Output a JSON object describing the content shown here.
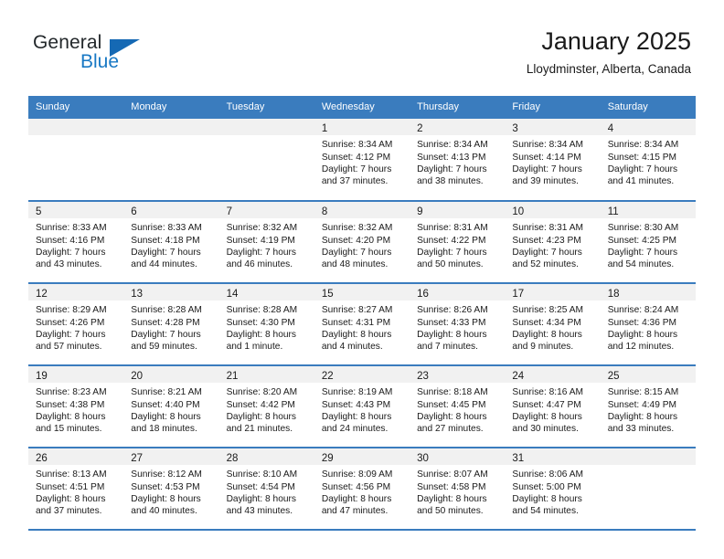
{
  "brand": {
    "name_part1": "General",
    "name_part2": "Blue",
    "triangle_color": "#1569b4"
  },
  "header": {
    "title": "January 2025",
    "location": "Lloydminster, Alberta, Canada"
  },
  "theme": {
    "header_blue": "#3a7cbe",
    "band_gray": "#f1f1f1",
    "text": "#1a1a1a"
  },
  "weekday_headers": [
    "Sunday",
    "Monday",
    "Tuesday",
    "Wednesday",
    "Thursday",
    "Friday",
    "Saturday"
  ],
  "weeks": [
    [
      {
        "day": "",
        "lines": []
      },
      {
        "day": "",
        "lines": []
      },
      {
        "day": "",
        "lines": []
      },
      {
        "day": "1",
        "lines": [
          "Sunrise: 8:34 AM",
          "Sunset: 4:12 PM",
          "Daylight: 7 hours",
          "and 37 minutes."
        ]
      },
      {
        "day": "2",
        "lines": [
          "Sunrise: 8:34 AM",
          "Sunset: 4:13 PM",
          "Daylight: 7 hours",
          "and 38 minutes."
        ]
      },
      {
        "day": "3",
        "lines": [
          "Sunrise: 8:34 AM",
          "Sunset: 4:14 PM",
          "Daylight: 7 hours",
          "and 39 minutes."
        ]
      },
      {
        "day": "4",
        "lines": [
          "Sunrise: 8:34 AM",
          "Sunset: 4:15 PM",
          "Daylight: 7 hours",
          "and 41 minutes."
        ]
      }
    ],
    [
      {
        "day": "5",
        "lines": [
          "Sunrise: 8:33 AM",
          "Sunset: 4:16 PM",
          "Daylight: 7 hours",
          "and 43 minutes."
        ]
      },
      {
        "day": "6",
        "lines": [
          "Sunrise: 8:33 AM",
          "Sunset: 4:18 PM",
          "Daylight: 7 hours",
          "and 44 minutes."
        ]
      },
      {
        "day": "7",
        "lines": [
          "Sunrise: 8:32 AM",
          "Sunset: 4:19 PM",
          "Daylight: 7 hours",
          "and 46 minutes."
        ]
      },
      {
        "day": "8",
        "lines": [
          "Sunrise: 8:32 AM",
          "Sunset: 4:20 PM",
          "Daylight: 7 hours",
          "and 48 minutes."
        ]
      },
      {
        "day": "9",
        "lines": [
          "Sunrise: 8:31 AM",
          "Sunset: 4:22 PM",
          "Daylight: 7 hours",
          "and 50 minutes."
        ]
      },
      {
        "day": "10",
        "lines": [
          "Sunrise: 8:31 AM",
          "Sunset: 4:23 PM",
          "Daylight: 7 hours",
          "and 52 minutes."
        ]
      },
      {
        "day": "11",
        "lines": [
          "Sunrise: 8:30 AM",
          "Sunset: 4:25 PM",
          "Daylight: 7 hours",
          "and 54 minutes."
        ]
      }
    ],
    [
      {
        "day": "12",
        "lines": [
          "Sunrise: 8:29 AM",
          "Sunset: 4:26 PM",
          "Daylight: 7 hours",
          "and 57 minutes."
        ]
      },
      {
        "day": "13",
        "lines": [
          "Sunrise: 8:28 AM",
          "Sunset: 4:28 PM",
          "Daylight: 7 hours",
          "and 59 minutes."
        ]
      },
      {
        "day": "14",
        "lines": [
          "Sunrise: 8:28 AM",
          "Sunset: 4:30 PM",
          "Daylight: 8 hours",
          "and 1 minute."
        ]
      },
      {
        "day": "15",
        "lines": [
          "Sunrise: 8:27 AM",
          "Sunset: 4:31 PM",
          "Daylight: 8 hours",
          "and 4 minutes."
        ]
      },
      {
        "day": "16",
        "lines": [
          "Sunrise: 8:26 AM",
          "Sunset: 4:33 PM",
          "Daylight: 8 hours",
          "and 7 minutes."
        ]
      },
      {
        "day": "17",
        "lines": [
          "Sunrise: 8:25 AM",
          "Sunset: 4:34 PM",
          "Daylight: 8 hours",
          "and 9 minutes."
        ]
      },
      {
        "day": "18",
        "lines": [
          "Sunrise: 8:24 AM",
          "Sunset: 4:36 PM",
          "Daylight: 8 hours",
          "and 12 minutes."
        ]
      }
    ],
    [
      {
        "day": "19",
        "lines": [
          "Sunrise: 8:23 AM",
          "Sunset: 4:38 PM",
          "Daylight: 8 hours",
          "and 15 minutes."
        ]
      },
      {
        "day": "20",
        "lines": [
          "Sunrise: 8:21 AM",
          "Sunset: 4:40 PM",
          "Daylight: 8 hours",
          "and 18 minutes."
        ]
      },
      {
        "day": "21",
        "lines": [
          "Sunrise: 8:20 AM",
          "Sunset: 4:42 PM",
          "Daylight: 8 hours",
          "and 21 minutes."
        ]
      },
      {
        "day": "22",
        "lines": [
          "Sunrise: 8:19 AM",
          "Sunset: 4:43 PM",
          "Daylight: 8 hours",
          "and 24 minutes."
        ]
      },
      {
        "day": "23",
        "lines": [
          "Sunrise: 8:18 AM",
          "Sunset: 4:45 PM",
          "Daylight: 8 hours",
          "and 27 minutes."
        ]
      },
      {
        "day": "24",
        "lines": [
          "Sunrise: 8:16 AM",
          "Sunset: 4:47 PM",
          "Daylight: 8 hours",
          "and 30 minutes."
        ]
      },
      {
        "day": "25",
        "lines": [
          "Sunrise: 8:15 AM",
          "Sunset: 4:49 PM",
          "Daylight: 8 hours",
          "and 33 minutes."
        ]
      }
    ],
    [
      {
        "day": "26",
        "lines": [
          "Sunrise: 8:13 AM",
          "Sunset: 4:51 PM",
          "Daylight: 8 hours",
          "and 37 minutes."
        ]
      },
      {
        "day": "27",
        "lines": [
          "Sunrise: 8:12 AM",
          "Sunset: 4:53 PM",
          "Daylight: 8 hours",
          "and 40 minutes."
        ]
      },
      {
        "day": "28",
        "lines": [
          "Sunrise: 8:10 AM",
          "Sunset: 4:54 PM",
          "Daylight: 8 hours",
          "and 43 minutes."
        ]
      },
      {
        "day": "29",
        "lines": [
          "Sunrise: 8:09 AM",
          "Sunset: 4:56 PM",
          "Daylight: 8 hours",
          "and 47 minutes."
        ]
      },
      {
        "day": "30",
        "lines": [
          "Sunrise: 8:07 AM",
          "Sunset: 4:58 PM",
          "Daylight: 8 hours",
          "and 50 minutes."
        ]
      },
      {
        "day": "31",
        "lines": [
          "Sunrise: 8:06 AM",
          "Sunset: 5:00 PM",
          "Daylight: 8 hours",
          "and 54 minutes."
        ]
      },
      {
        "day": "",
        "lines": []
      }
    ]
  ]
}
